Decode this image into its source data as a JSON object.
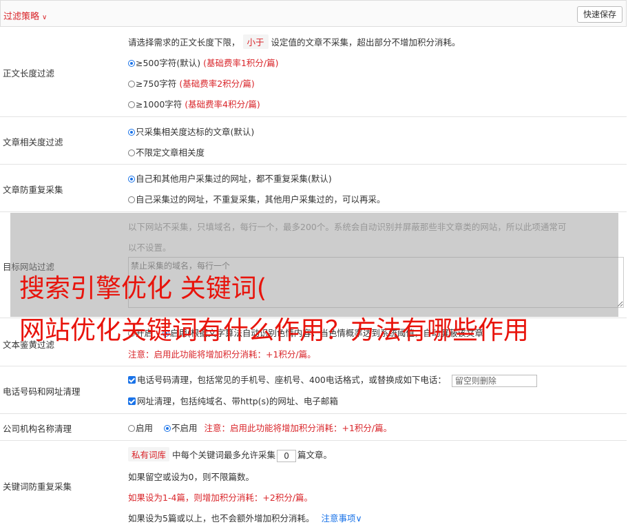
{
  "topbar": {
    "title": "过滤策略",
    "save_label": "快速保存"
  },
  "length_filter": {
    "label": "正文长度过滤",
    "desc_a": "请选择需求的正文长度下限，",
    "tag": "小于",
    "desc_b": "设定值的文章不采集，超出部分不增加积分消耗。",
    "options": [
      {
        "text": "≥500字符(默认)",
        "note": "(基础费率1积分/篇)"
      },
      {
        "text": "≥750字符",
        "note": "(基础费率2积分/篇)"
      },
      {
        "text": "≥1000字符",
        "note": "(基础费率4积分/篇)"
      }
    ]
  },
  "relevance": {
    "label": "文章相关度过滤",
    "options": [
      "只采集相关度达标的文章(默认)",
      "不限定文章相关度"
    ]
  },
  "dedupe": {
    "label": "文章防重复采集",
    "options": [
      "自己和其他用户采集过的网址，都不重复采集(默认)",
      "自己采集过的网址，不重复采集，其他用户采集过的，可以再采。"
    ]
  },
  "site_filter": {
    "label": "目标网站过滤",
    "desc_1": "以下网站不采集，只填域名，每行一个，最多200个。系统会自动识别并屏蔽那些非文章类的网站，所以此项通常可",
    "desc_2": "以不设置。",
    "placeholder": "禁止采集的域名，每行一个"
  },
  "porn_filter": {
    "label": "文本鉴黄过滤",
    "option_on": "开启",
    "hidden_text": "启用(根据文字算法自动识别色情内容，当色情概率达到系统阈值，自动屏蔽该文章",
    "note": "注意：启用此功能将增加积分消耗：+1积分/篇。"
  },
  "contact_clean": {
    "label": "电话号码和网址清理",
    "phone": "电话号码清理，包括常见的手机号、座机号、400电话格式，或替换成如下电话：",
    "phone_placeholder": "留空则删除",
    "url": "网址清理，包括纯域名、带http(s)的网址、电子邮箱"
  },
  "org_clean": {
    "label": "公司机构名称清理",
    "enable": "启用",
    "disable": "不启用",
    "note": "注意：启用此功能将增加积分消耗：+1积分/篇。"
  },
  "keyword_dedupe": {
    "label": "关键词防重复采集",
    "tag": "私有词库",
    "text_a": "中每个关键词最多允许采集",
    "value": "0",
    "text_b": "篇文章。",
    "line_2": "如果留空或设为0，则不限篇数。",
    "line_3": "如果设为1-4篇，则增加积分消耗：+2积分/篇。",
    "line_4": "如果设为5篇或以上，也不会额外增加积分消耗。",
    "link": "注意事项"
  },
  "headline": {
    "line_1": "搜索引擎优化 关键词(",
    "line_2": "网站优化关键词有什么作用？方法有哪些作用"
  }
}
